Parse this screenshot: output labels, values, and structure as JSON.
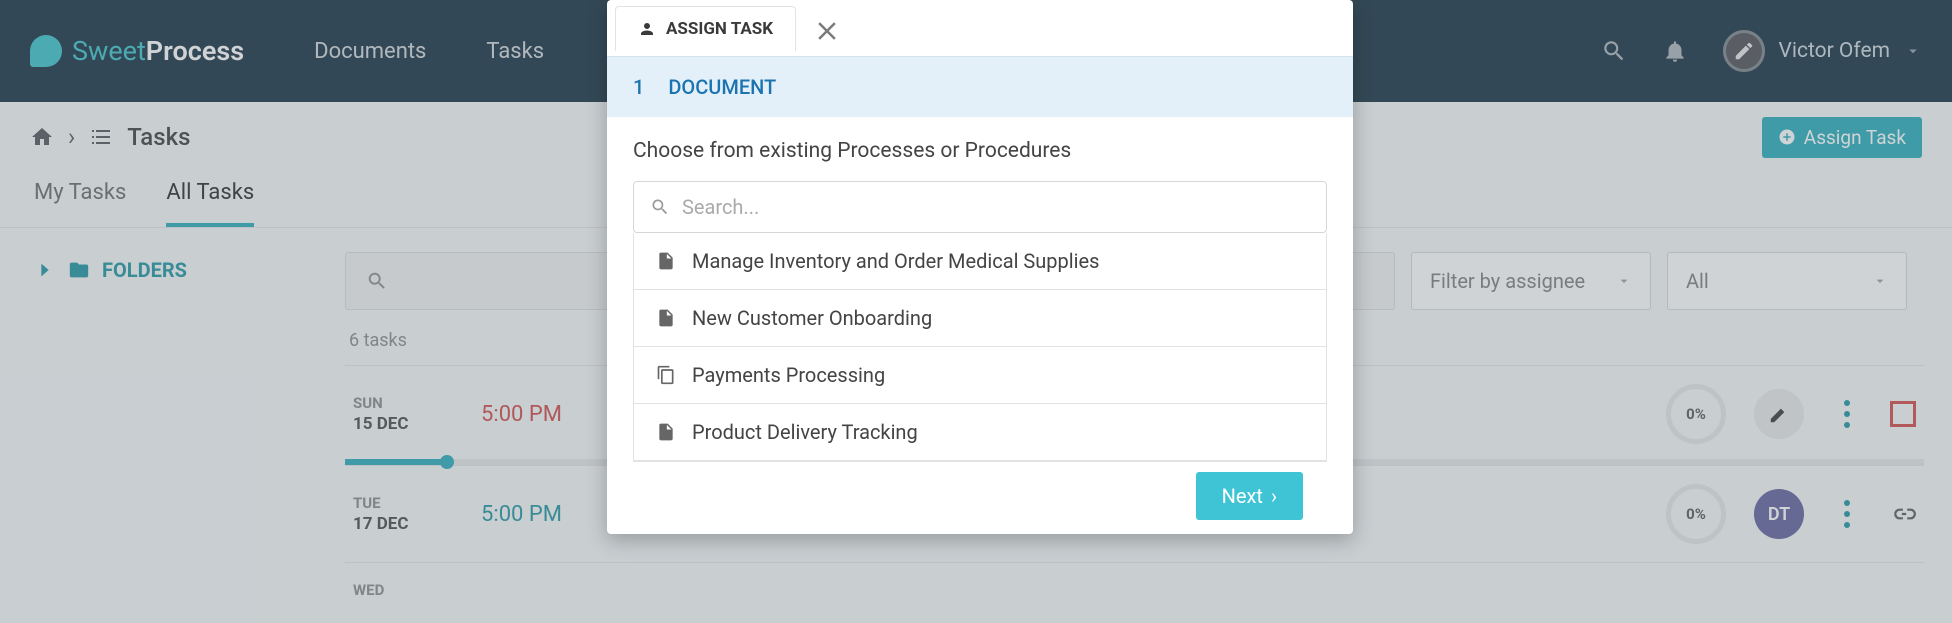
{
  "header": {
    "logo_sweet": "Sweet",
    "logo_process": "Process",
    "nav": [
      "Documents",
      "Tasks"
    ],
    "user_name": "Victor Ofem"
  },
  "breadcrumb": {
    "tasks": "Tasks",
    "assign_btn": "Assign Task"
  },
  "tabs": {
    "my": "My Tasks",
    "all": "All Tasks"
  },
  "sidebar": {
    "folders": "FOLDERS"
  },
  "filters": {
    "assignee": "Filter by assignee",
    "status": "All"
  },
  "count_label": "6 tasks",
  "rows": [
    {
      "dow": "SUN",
      "date": "15 DEC",
      "time": "5:00 PM",
      "pct": "0%",
      "avatar_type": "pen",
      "avatar_text": "",
      "time_class": "t-red",
      "end": "box"
    },
    {
      "dow": "TUE",
      "date": "17 DEC",
      "time": "5:00 PM",
      "pct": "0%",
      "avatar_type": "txt",
      "avatar_text": "DT",
      "time_class": "t-teal",
      "end": "link"
    },
    {
      "dow": "WED",
      "date": "",
      "time": "",
      "pct": "",
      "avatar_type": "",
      "avatar_text": "",
      "time_class": "",
      "end": ""
    }
  ],
  "modal": {
    "tab_label": "ASSIGN TASK",
    "step_num": "1",
    "step_label": "DOCUMENT",
    "prompt": "Choose from existing Processes or Procedures",
    "search_placeholder": "Search...",
    "items": [
      {
        "label": "Manage Inventory and Order Medical Supplies",
        "icon": "doc"
      },
      {
        "label": "New Customer Onboarding",
        "icon": "doc"
      },
      {
        "label": "Payments Processing",
        "icon": "copy"
      },
      {
        "label": "Product Delivery Tracking",
        "icon": "doc"
      }
    ],
    "next": "Next"
  }
}
